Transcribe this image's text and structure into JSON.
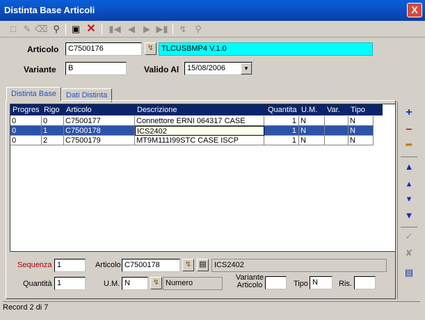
{
  "window": {
    "title": "Distinta Base Articoli",
    "close_label": "X"
  },
  "header": {
    "articolo_label": "Articolo",
    "articolo_value": "C7500176",
    "articolo_desc": "TLCUSBMP4 V.1.0",
    "variante_label": "Variante",
    "variante_value": "B",
    "valido_label": "Valido Al",
    "valido_value": "15/08/2006"
  },
  "tabs": [
    {
      "label": "Distinta Base"
    },
    {
      "label": "Dati Distinta"
    }
  ],
  "grid": {
    "columns": [
      "Progres",
      "Rigo",
      "Articolo",
      "Descrizione",
      "Quantita",
      "U.M.",
      "Var.",
      "Tipo"
    ],
    "rows": [
      {
        "progres": "0",
        "rigo": "0",
        "articolo": "C7500177",
        "descrizione": "Connettore ERNI 064317 CASE",
        "quantita": "1",
        "um": "N",
        "var": "",
        "tipo": "N"
      },
      {
        "progres": "0",
        "rigo": "1",
        "articolo": "C7500178",
        "descrizione": "ICS2402",
        "quantita": "1",
        "um": "N",
        "var": "",
        "tipo": "N"
      },
      {
        "progres": "0",
        "rigo": "2",
        "articolo": "C7500179",
        "descrizione": "MT9M111I99STC CASE ISCP",
        "quantita": "1",
        "um": "N",
        "var": "",
        "tipo": "N"
      }
    ],
    "selected_index": 1
  },
  "detail": {
    "sequenza_label": "Sequenza",
    "sequenza_value": "1",
    "articolo_label": "Articolo",
    "articolo_value": "C7500178",
    "articolo_desc": "ICS2402",
    "quantita_label": "Quantità",
    "quantita_value": "1",
    "um_label": "U.M.",
    "um_value": "N",
    "um_desc": "Numero",
    "variante_label_1": "Variante",
    "variante_label_2": "Articolo",
    "variante_value": "",
    "tipo_label": "Tipo",
    "tipo_value": "N",
    "ris_label": "Ris.",
    "ris_value": ""
  },
  "status": {
    "text": "Record 2 di 7"
  },
  "colors": {
    "title_bar": "#0a4bc0",
    "grid_header": "#0a246a",
    "selection": "#2b54a8",
    "desc_highlight": "#00ffff",
    "sequenza_label": "#b00000"
  },
  "icons": [
    "new-icon",
    "edit-icon",
    "delete-icon",
    "search-icon",
    "save-icon",
    "cancel-icon",
    "first-icon",
    "prev-icon",
    "next-icon",
    "last-icon",
    "filter-icon",
    "find-icon",
    "add-row-icon",
    "remove-row-icon",
    "insert-row-icon",
    "move-top-icon",
    "move-up-icon",
    "move-down-icon",
    "move-bottom-icon",
    "confirm-icon",
    "discard-icon",
    "list-icon"
  ]
}
